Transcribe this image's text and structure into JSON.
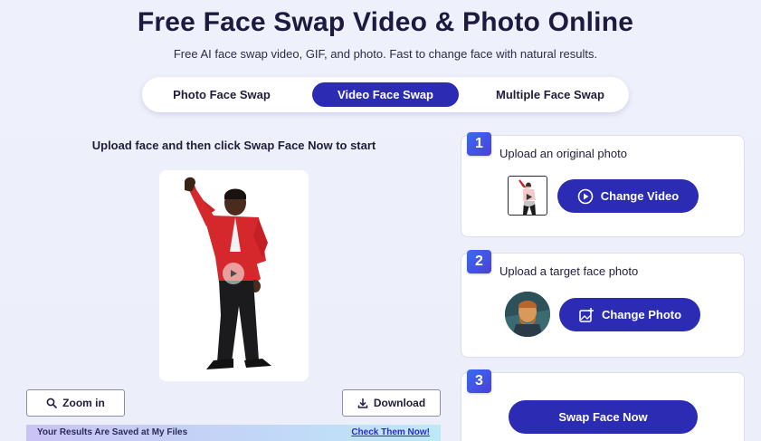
{
  "header": {
    "title": "Free Face Swap Video & Photo Online",
    "subtitle": "Free AI face swap video, GIF, and photo. Fast to change face with natural results."
  },
  "tabs": [
    {
      "label": "Photo Face Swap",
      "active": false
    },
    {
      "label": "Video Face Swap",
      "active": true
    },
    {
      "label": "Multiple Face Swap",
      "active": false
    }
  ],
  "left": {
    "upload_hint": "Upload face and then click Swap Face Now to start",
    "zoom_label": "Zoom in",
    "download_label": "Download",
    "saved_message": "Your Results Are Saved at My Files",
    "saved_link": "Check Them Now!"
  },
  "steps": [
    {
      "number": "1",
      "label": "Upload an original photo",
      "button": "Change Video",
      "button_icon": "play-circle-icon"
    },
    {
      "number": "2",
      "label": "Upload a target face photo",
      "button": "Change Photo",
      "button_icon": "image-add-icon"
    },
    {
      "number": "3",
      "button": "Swap Face Now"
    }
  ],
  "colors": {
    "primary": "#2b2bb3",
    "badge": "#3f55e0",
    "background": "#eef0fb"
  }
}
